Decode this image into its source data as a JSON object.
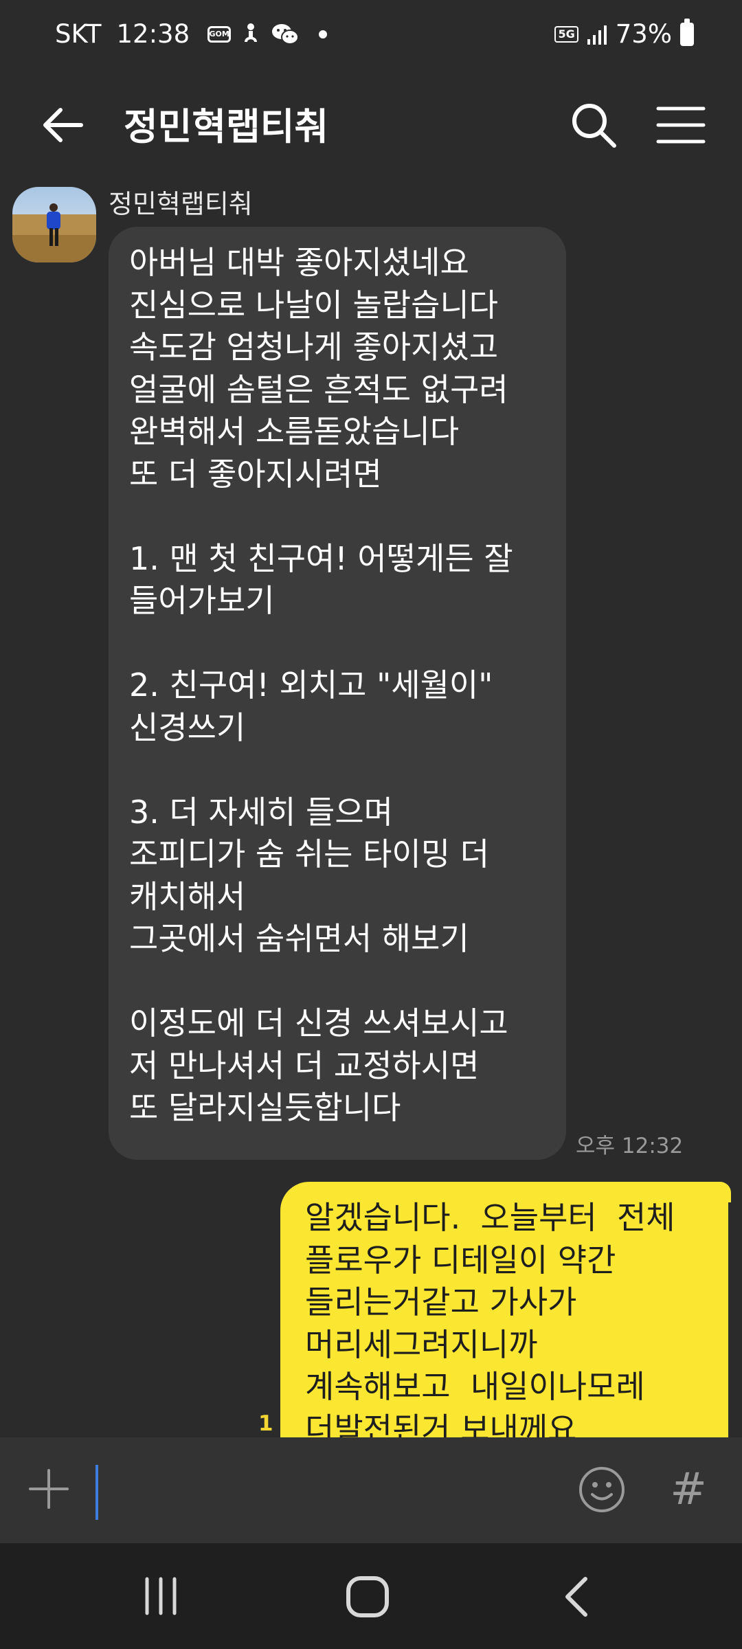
{
  "status_bar": {
    "carrier": "SKT",
    "time": "12:38",
    "gom_badge": "GOM",
    "network": "5G",
    "battery": "73%",
    "icons": [
      "gom-icon",
      "accessibility-icon",
      "wechat-icon",
      "dot-icon",
      "5g-icon",
      "signal-icon",
      "battery-icon"
    ]
  },
  "header": {
    "title": "정민혁랩티춰",
    "icons": [
      "back-arrow-icon",
      "search-icon",
      "menu-icon"
    ]
  },
  "messages": [
    {
      "direction": "incoming",
      "sender": "정민혁랩티춰",
      "text": "아버님 대박 좋아지셨네요\n진심으로 나날이 놀랍습니다\n속도감 엄청나게 좋아지셨고\n얼굴에 솜털은 흔적도 없구려\n완벽해서 소름돋았습니다\n또 더 좋아지시려면\n\n1. 맨 첫 친구여! 어떻게든 잘\n들어가보기\n\n2. 친구여! 외치고 \"세월이\"\n신경쓰기\n\n3. 더 자세히 들으며\n조피디가 숨 쉬는 타이밍 더\n캐치해서\n그곳에서 숨쉬면서 해보기\n\n이정도에 더 신경 쓰셔보시고\n저 만나셔서 더 교정하시면\n또 달라지실듯합니다",
      "time": "오후 12:32"
    },
    {
      "direction": "outgoing",
      "text": "알겠습니다.  오늘부터  전체\n플로우가 디테일이 약간\n들리는거같고 가사가\n머리세그려지니까\n계속해보고  내일이나모레\n더발전된거 보내께요",
      "unread": "1"
    }
  ],
  "input": {
    "value": "",
    "icons": [
      "plus-icon",
      "emoji-icon",
      "hash-icon"
    ],
    "hash_symbol": "#"
  },
  "colors": {
    "background": "#2b2b2b",
    "incoming_bubble": "#3c3c3c",
    "outgoing_bubble": "#fbe632",
    "unread": "#f3d632"
  }
}
